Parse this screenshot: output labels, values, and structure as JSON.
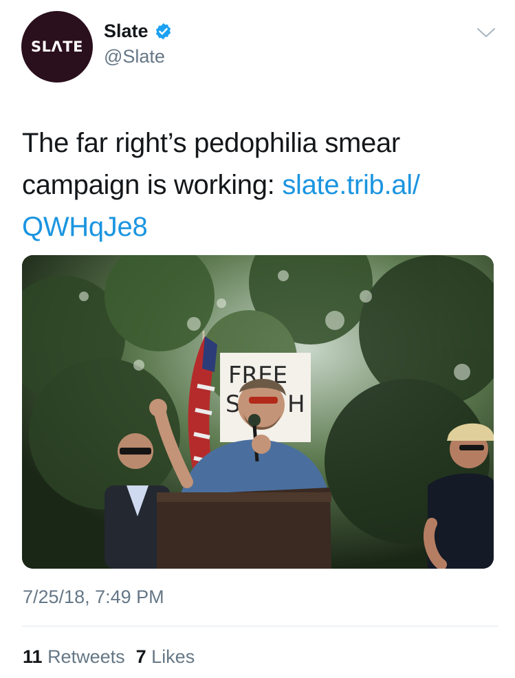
{
  "author": {
    "avatar_text": "SLΛTE",
    "display_name": "Slate",
    "handle": "@Slate",
    "verified_icon": "verified-badge-icon"
  },
  "tweet": {
    "text": "The far right’s pedophilia smear campaign is working: ",
    "link": "slate.trib.al/QWHqJe8",
    "link_line1": "slate.trib.al/",
    "link_line2": "QWHqJe8"
  },
  "media": {
    "sign_text_1": "FREE",
    "sign_text_2": "SP",
    "sign_text_3": "H"
  },
  "timestamp": "7/25/18, 7:49 PM",
  "stats": {
    "retweets_count": "11",
    "retweets_label": "Retweets",
    "likes_count": "7",
    "likes_label": "Likes"
  },
  "colors": {
    "link": "#1b95e0",
    "secondary_text": "#657786",
    "avatar_bg": "#2a0f1c",
    "verified": "#1da1f2"
  }
}
